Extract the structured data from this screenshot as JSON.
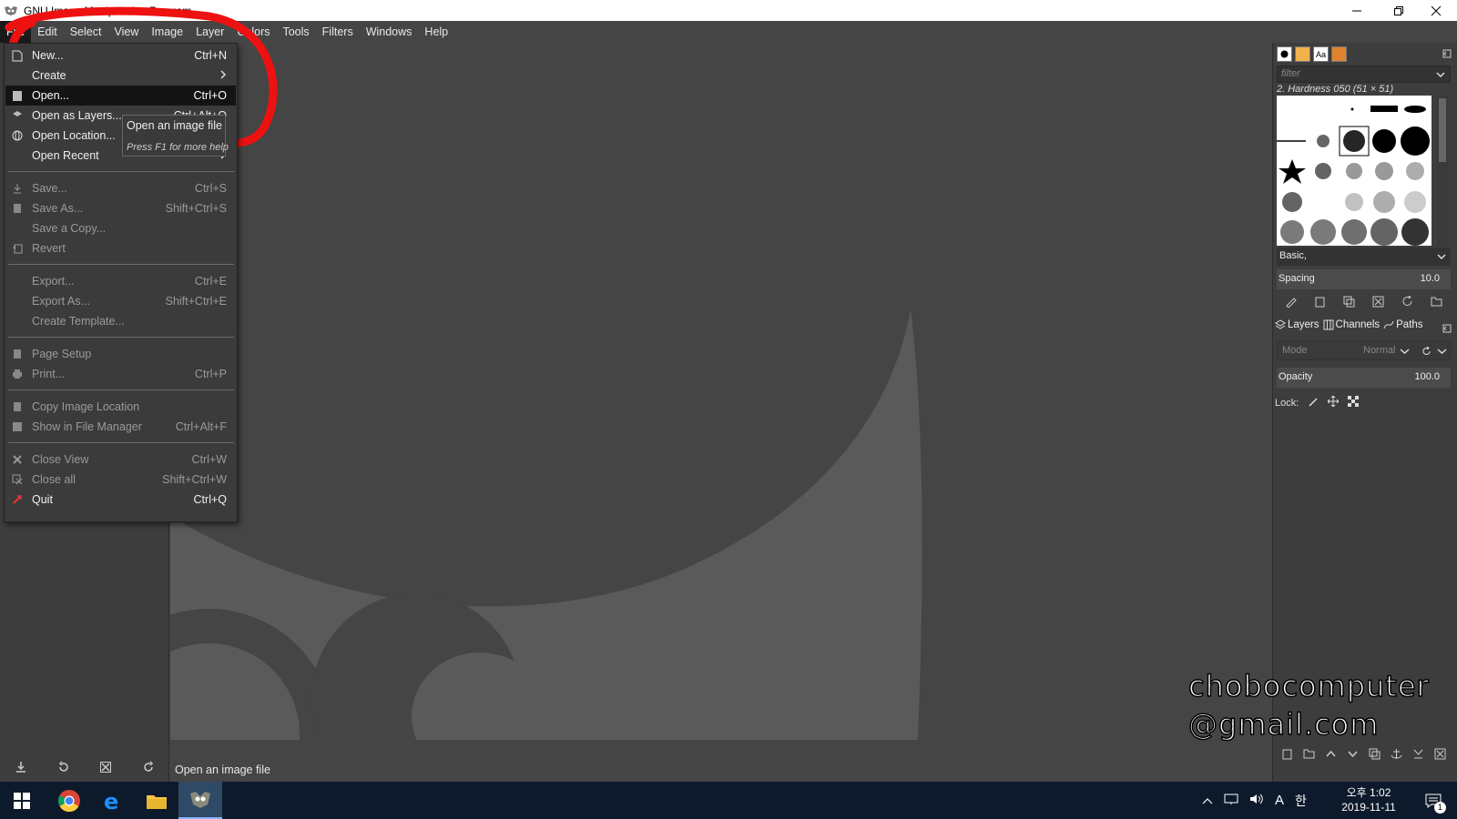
{
  "window": {
    "title": "GNU Image Manipulation Program"
  },
  "menubar": [
    "File",
    "Edit",
    "Select",
    "View",
    "Image",
    "Layer",
    "Colors",
    "Tools",
    "Filters",
    "Windows",
    "Help"
  ],
  "file_menu": {
    "items": [
      {
        "label": "New...",
        "shortcut": "Ctrl+N",
        "state": "enabled",
        "icon": "new-image-icon"
      },
      {
        "label": "Create",
        "shortcut": "",
        "state": "enabled",
        "icon": "",
        "submenu": true
      },
      {
        "label": "Open...",
        "shortcut": "Ctrl+O",
        "state": "selected",
        "icon": "open-icon"
      },
      {
        "label": "Open as Layers...",
        "shortcut": "Ctrl+Alt+O",
        "state": "enabled",
        "icon": "open-layers-icon"
      },
      {
        "label": "Open Location...",
        "shortcut": "",
        "state": "enabled",
        "icon": "globe-icon"
      },
      {
        "label": "Open Recent",
        "shortcut": "",
        "state": "enabled",
        "icon": "",
        "submenu": true
      },
      {
        "label": "Save...",
        "shortcut": "Ctrl+S",
        "state": "disabled",
        "icon": "save-icon"
      },
      {
        "label": "Save As...",
        "shortcut": "Shift+Ctrl+S",
        "state": "disabled",
        "icon": "save-as-icon"
      },
      {
        "label": "Save a Copy...",
        "shortcut": "",
        "state": "disabled",
        "icon": ""
      },
      {
        "label": "Revert",
        "shortcut": "",
        "state": "disabled",
        "icon": "revert-icon"
      },
      {
        "label": "Export...",
        "shortcut": "Ctrl+E",
        "state": "disabled",
        "icon": ""
      },
      {
        "label": "Export As...",
        "shortcut": "Shift+Ctrl+E",
        "state": "disabled",
        "icon": ""
      },
      {
        "label": "Create Template...",
        "shortcut": "",
        "state": "disabled",
        "icon": ""
      },
      {
        "label": "Page Setup",
        "shortcut": "",
        "state": "disabled",
        "icon": "page-setup-icon"
      },
      {
        "label": "Print...",
        "shortcut": "Ctrl+P",
        "state": "disabled",
        "icon": "print-icon"
      },
      {
        "label": "Copy Image Location",
        "shortcut": "",
        "state": "disabled",
        "icon": "copy-location-icon"
      },
      {
        "label": "Show in File Manager",
        "shortcut": "Ctrl+Alt+F",
        "state": "disabled",
        "icon": "file-manager-icon"
      },
      {
        "label": "Close View",
        "shortcut": "Ctrl+W",
        "state": "disabled",
        "icon": "close-icon"
      },
      {
        "label": "Close all",
        "shortcut": "Shift+Ctrl+W",
        "state": "disabled",
        "icon": "close-all-icon"
      },
      {
        "label": "Quit",
        "shortcut": "Ctrl+Q",
        "state": "enabled",
        "icon": "quit-icon"
      }
    ]
  },
  "tooltip": {
    "title": "Open an image file",
    "hint": "Press F1 for more help"
  },
  "statusbar": {
    "text": "Open an image file"
  },
  "brushes": {
    "filter_placeholder": "filter",
    "current": "2. Hardness 050 (51 × 51)",
    "tag": "Basic,",
    "spacing_label": "Spacing",
    "spacing_value": "10.0"
  },
  "layers": {
    "tabs": [
      "Layers",
      "Channels",
      "Paths"
    ],
    "mode_label": "Mode",
    "mode_value": "Normal",
    "opacity_label": "Opacity",
    "opacity_value": "100.0",
    "lock_label": "Lock:"
  },
  "watermark": {
    "line1": "chobocomputer",
    "line2": "@gmail.com"
  },
  "taskbar": {
    "time": "오후 1:02",
    "date": "2019-11-11",
    "ime": "A",
    "ime2": "한",
    "notification_count": "1"
  }
}
